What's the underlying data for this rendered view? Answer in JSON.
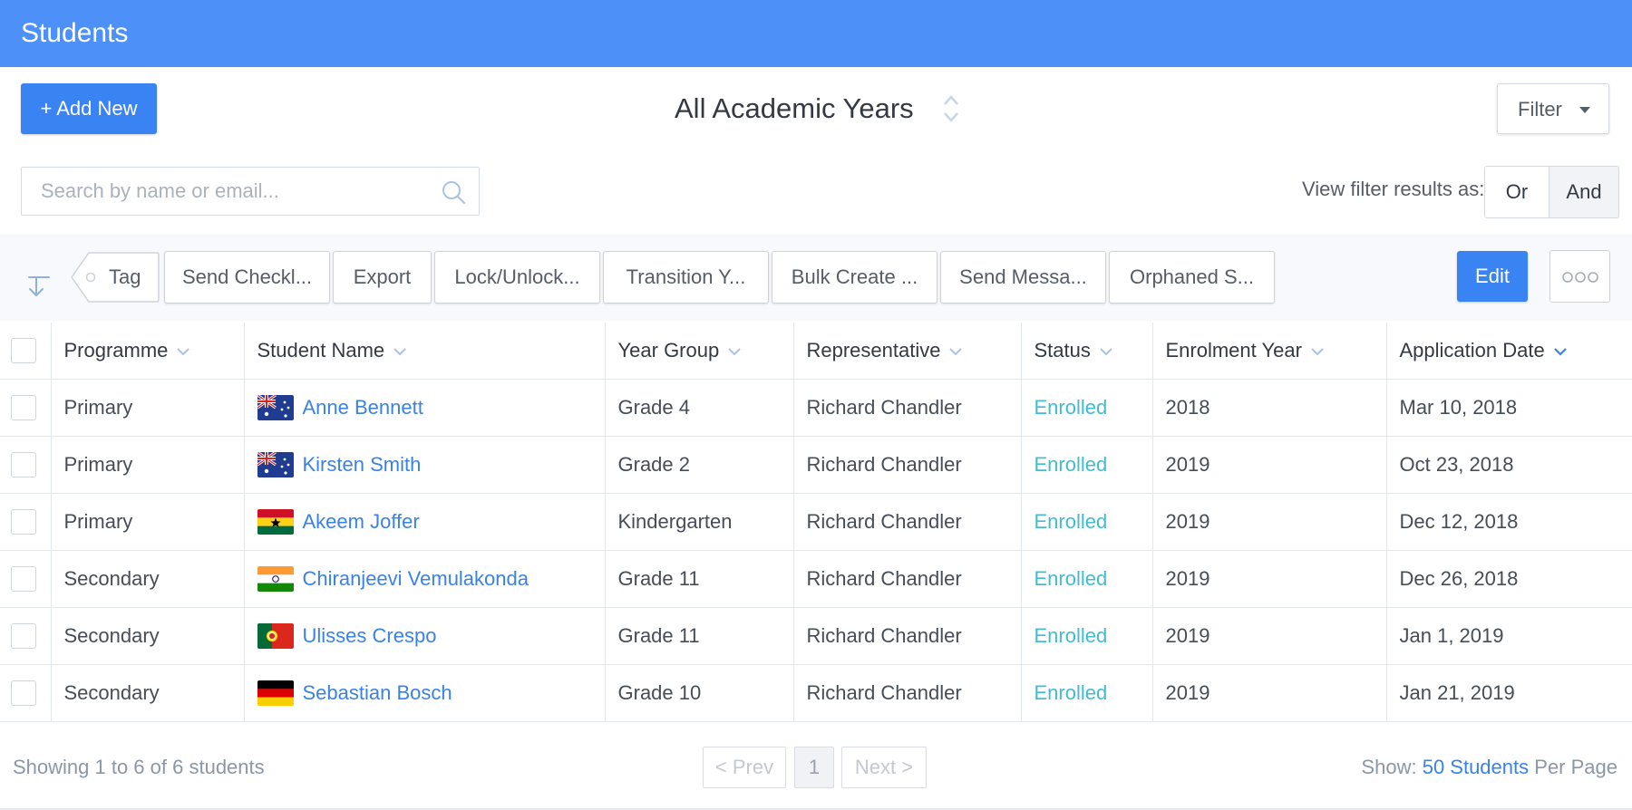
{
  "app": {
    "title": "Students"
  },
  "toolbar_top": {
    "add_new_label": "+ Add New",
    "year_selector": "All Academic Years",
    "filter_label": "Filter"
  },
  "search": {
    "placeholder": "Search by name or email..."
  },
  "view_filter": {
    "label": "View filter results as:",
    "or_label": "Or",
    "and_label": "And",
    "selected": "And"
  },
  "actions": {
    "tag_label": "Tag",
    "buttons": [
      "Send Checkl...",
      "Export",
      "Lock/Unlock...",
      "Transition Y...",
      "Bulk Create ...",
      "Send Messa...",
      "Orphaned S..."
    ],
    "edit_label": "Edit"
  },
  "table": {
    "columns": [
      "Programme",
      "Student Name",
      "Year Group",
      "Representative",
      "Status",
      "Enrolment Year",
      "Application Date"
    ],
    "rows": [
      {
        "programme": "Primary",
        "flag": "australia",
        "name": "Anne Bennett",
        "year_group": "Grade 4",
        "representative": "Richard Chandler",
        "status": "Enrolled",
        "enrolment_year": "2018",
        "application_date": "Mar 10, 2018"
      },
      {
        "programme": "Primary",
        "flag": "australia",
        "name": "Kirsten Smith",
        "year_group": "Grade 2",
        "representative": "Richard Chandler",
        "status": "Enrolled",
        "enrolment_year": "2019",
        "application_date": "Oct 23, 2018"
      },
      {
        "programme": "Primary",
        "flag": "ghana",
        "name": "Akeem Joffer",
        "year_group": "Kindergarten",
        "representative": "Richard Chandler",
        "status": "Enrolled",
        "enrolment_year": "2019",
        "application_date": "Dec 12, 2018"
      },
      {
        "programme": "Secondary",
        "flag": "india",
        "name": "Chiranjeevi Vemulakonda",
        "year_group": "Grade 11",
        "representative": "Richard Chandler",
        "status": "Enrolled",
        "enrolment_year": "2019",
        "application_date": "Dec 26, 2018"
      },
      {
        "programme": "Secondary",
        "flag": "portugal",
        "name": "Ulisses Crespo",
        "year_group": "Grade 11",
        "representative": "Richard Chandler",
        "status": "Enrolled",
        "enrolment_year": "2019",
        "application_date": "Jan 1, 2019"
      },
      {
        "programme": "Secondary",
        "flag": "germany",
        "name": "Sebastian Bosch",
        "year_group": "Grade 10",
        "representative": "Richard Chandler",
        "status": "Enrolled",
        "enrolment_year": "2019",
        "application_date": "Jan 21, 2019"
      }
    ]
  },
  "footer": {
    "showing": "Showing 1 to 6 of 6 students",
    "prev_label": "< Prev",
    "page": "1",
    "next_label": "Next >",
    "show_label": "Show:",
    "per_page_value": "50 Students",
    "per_page_suffix": "Per Page"
  },
  "colors": {
    "header_bg": "#4d90f7",
    "primary": "#3a83f2",
    "link": "#3a82e4",
    "status_enrolled": "#41bcd1"
  }
}
